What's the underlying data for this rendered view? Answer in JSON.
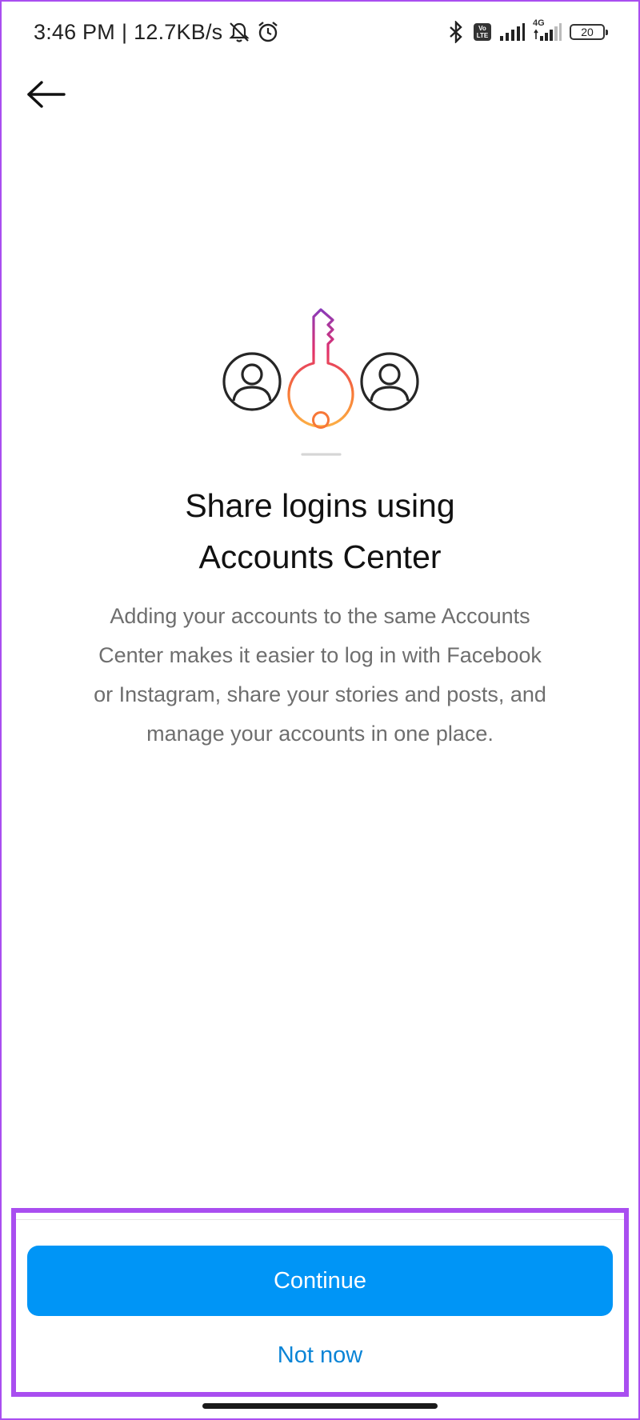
{
  "status_bar": {
    "time": "3:46 PM",
    "separator": "|",
    "network_speed": "12.7KB/s",
    "icons_left": [
      "mute-notifications-icon",
      "alarm-icon"
    ],
    "icons_right": [
      "bluetooth-icon",
      "volte-icon",
      "signal-icon",
      "4g-signal-icon",
      "battery-icon"
    ],
    "volte_label_top": "Vo",
    "volte_label_bottom": "LTE",
    "network_type": "4G",
    "battery_level": "20"
  },
  "header": {
    "back_icon": "back-arrow-icon"
  },
  "illustration": {
    "icons": [
      "user-circle-icon",
      "key-icon",
      "user-circle-icon"
    ],
    "gradient_colors": [
      "#8a3ab9",
      "#e1306c",
      "#f77737",
      "#fcaf45"
    ]
  },
  "content": {
    "title_line1": "Share logins using",
    "title_line2": "Accounts Center",
    "description_line1": "Adding your accounts to the same Accounts",
    "description_line2": "Center makes it easier to log in with Facebook",
    "description_line3": "or Instagram, share your stories and posts, and",
    "description_line4": "manage your accounts in one place."
  },
  "actions": {
    "continue_label": "Continue",
    "not_now_label": "Not now"
  },
  "colors": {
    "primary_button": "#0095f6",
    "link": "#0a84d6",
    "highlight": "#a94ef0"
  }
}
